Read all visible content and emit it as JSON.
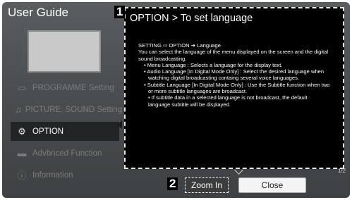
{
  "header": {
    "title": "User Guide"
  },
  "menu": {
    "items": [
      {
        "label": "PROGRAMME Setting",
        "icon": "tv-icon"
      },
      {
        "label": "PICTURE, SOUND Setting",
        "icon": "picture-sound-icon"
      },
      {
        "label": "OPTION",
        "icon": "gear-icon",
        "active": true
      },
      {
        "label": "Advbnced Function",
        "icon": "advanced-icon"
      },
      {
        "label": "Information",
        "icon": "info-icon"
      }
    ]
  },
  "callouts": {
    "one": "1",
    "two": "2"
  },
  "panel": {
    "title": "OPTION > To set language",
    "lines": [
      "SETTING ⇨ OPTION ➔ Language",
      "You can select the language of the menu displayed on the screen and the digital",
      "sound broadcasting.",
      "• Menu Language : Selects a language for the display text.",
      "• Audio Language  [In Digital Mode Only] : Select the desired language when",
      "watching digital broadcasting containg several voice languages.",
      "• Subtitle Language [In Digital Mode Only] : Use the Subtitle function when two",
      "or more subtitle languages are broadcast.",
      "• If subtitle data in a selected language is not broadcast,  the default",
      "language subtitle will be displayed."
    ],
    "page": "1/2"
  },
  "buttons": {
    "zoom": "Zoom In",
    "close": "Close"
  },
  "colors": {
    "background": "#4b4e50",
    "panel": "#000000",
    "text": "#ffffff"
  }
}
